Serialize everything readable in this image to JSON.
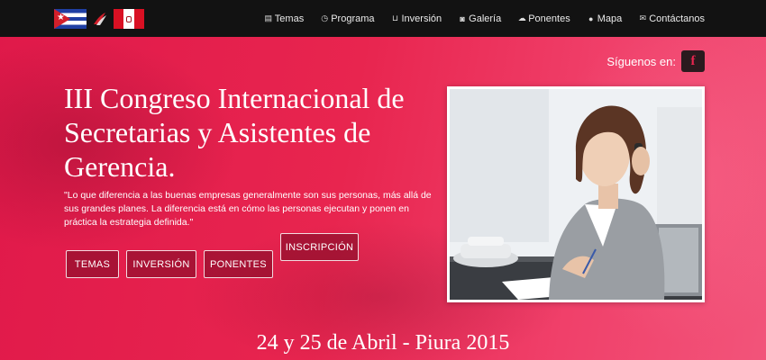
{
  "header": {
    "flags": [
      {
        "country": "Cuba",
        "icon": "cuba-flag-icon"
      },
      {
        "country": "Peru",
        "icon": "peru-flag-icon"
      }
    ],
    "nav": [
      {
        "label": "Temas",
        "icon": "list-icon"
      },
      {
        "label": "Programa",
        "icon": "clock-icon"
      },
      {
        "label": "Inversión",
        "icon": "cart-icon"
      },
      {
        "label": "Galería",
        "icon": "camera-icon"
      },
      {
        "label": "Ponentes",
        "icon": "users-icon"
      },
      {
        "label": "Mapa",
        "icon": "map-marker-icon"
      },
      {
        "label": "Contáctanos",
        "icon": "envelope-icon"
      }
    ]
  },
  "social": {
    "label": "Síguenos en:",
    "icon": "facebook-icon",
    "glyph": "f"
  },
  "hero": {
    "title": "III Congreso Internacional de Secretarias y Asistentes de Gerencia.",
    "quote": "\"Lo que diferencia a las buenas empresas generalmente son sus personas, más allá de sus grandes planes. La diferencia está en cómo las personas ejecutan y ponen en práctica la estrategia definida.\"",
    "buttons": {
      "temas": "TEMAS",
      "inversion": "INVERSIÓN",
      "ponentes": "PONENTES",
      "inscripcion": "INSCRIPCIÓN"
    },
    "date": "24 y 25 de Abril - Piura 2015"
  },
  "colors": {
    "background": "#e8254f",
    "topbar": "#121212",
    "button_bg": "#7a0a23"
  }
}
